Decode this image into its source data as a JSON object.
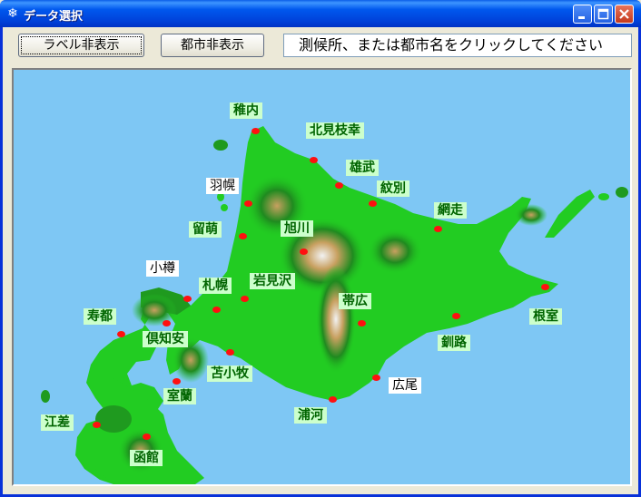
{
  "window": {
    "title": "データ選択",
    "icon": "snowflake-icon"
  },
  "toolbar": {
    "toggle_labels_button": "ラベル非表示",
    "toggle_cities_button": "都市非表示"
  },
  "status": {
    "message": "測候所、または都市名をクリックしてください"
  },
  "map": {
    "colors": {
      "sea": "#7ec7f4",
      "lowland": "#22cc22",
      "highland": "#1f8a1f",
      "mountain": "#c8a060",
      "peak": "#f2f2f2",
      "city_dot": "#ff1010",
      "label_green_bg": "#ccffcc",
      "label_green_text": "#006400"
    },
    "cities": [
      {
        "id": "wakkanai",
        "name": "稚内",
        "style": "green"
      },
      {
        "id": "kitami-esashi",
        "name": "北見枝幸",
        "style": "green"
      },
      {
        "id": "omu",
        "name": "雄武",
        "style": "green"
      },
      {
        "id": "monbetsu",
        "name": "紋別",
        "style": "green"
      },
      {
        "id": "haboro",
        "name": "羽幌",
        "style": "white"
      },
      {
        "id": "abashiri",
        "name": "網走",
        "style": "green"
      },
      {
        "id": "rumoi",
        "name": "留萌",
        "style": "green"
      },
      {
        "id": "asahikawa",
        "name": "旭川",
        "style": "green"
      },
      {
        "id": "otaru",
        "name": "小樽",
        "style": "white"
      },
      {
        "id": "iwamizawa",
        "name": "岩見沢",
        "style": "green"
      },
      {
        "id": "sapporo",
        "name": "札幌",
        "style": "green"
      },
      {
        "id": "obihiro",
        "name": "帯広",
        "style": "green"
      },
      {
        "id": "nemuro",
        "name": "根室",
        "style": "green"
      },
      {
        "id": "suttsu",
        "name": "寿都",
        "style": "green"
      },
      {
        "id": "kutchan",
        "name": "倶知安",
        "style": "green"
      },
      {
        "id": "kushiro",
        "name": "釧路",
        "style": "green"
      },
      {
        "id": "tomakomai",
        "name": "苫小牧",
        "style": "green"
      },
      {
        "id": "hiroo",
        "name": "広尾",
        "style": "white"
      },
      {
        "id": "muroran",
        "name": "室蘭",
        "style": "green"
      },
      {
        "id": "urakawa",
        "name": "浦河",
        "style": "green"
      },
      {
        "id": "esashi",
        "name": "江差",
        "style": "green"
      },
      {
        "id": "hakodate",
        "name": "函館",
        "style": "green"
      }
    ]
  }
}
